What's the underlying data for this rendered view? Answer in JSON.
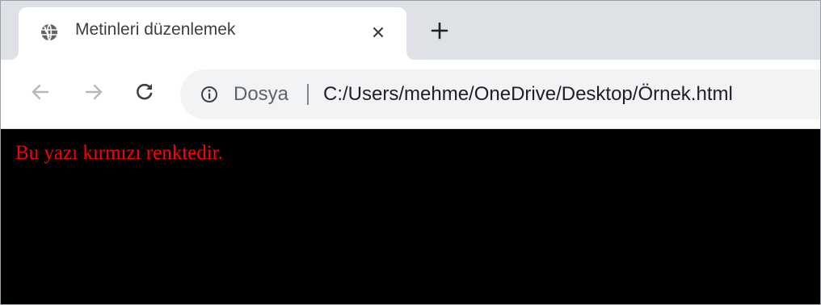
{
  "tab": {
    "title": "Metinleri düzenlemek",
    "favicon": "globe-icon",
    "close_icon": "close-icon"
  },
  "new_tab_icon": "plus-icon",
  "toolbar": {
    "back_icon": "arrow-left-icon",
    "forward_icon": "arrow-right-icon",
    "reload_icon": "reload-icon"
  },
  "omnibox": {
    "info_icon": "info-icon",
    "scheme_label": "Dosya",
    "url": "C:/Users/mehme/OneDrive/Desktop/Örnek.html"
  },
  "page": {
    "background": "#000000",
    "text": "Bu yazı kırmızı renktedir.",
    "text_color": "#ff0000"
  }
}
